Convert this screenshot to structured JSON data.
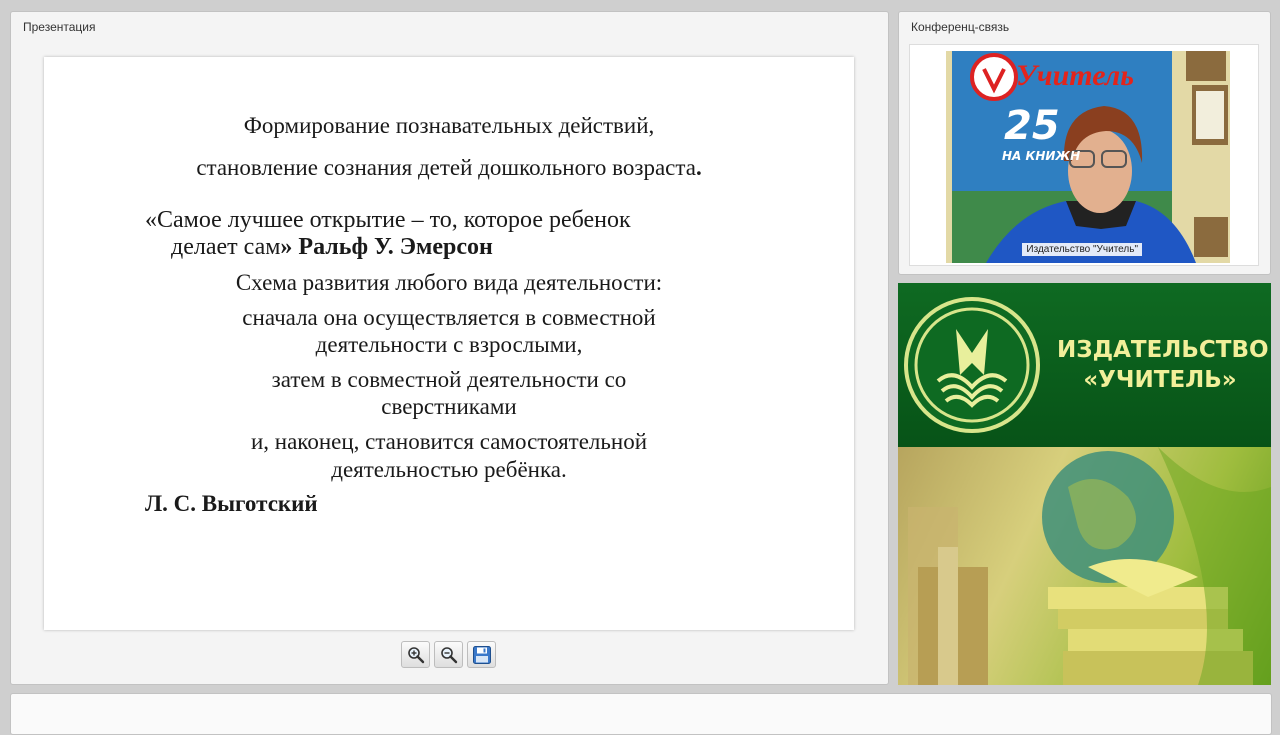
{
  "presentation": {
    "title": "Презентация",
    "slide": {
      "line1": "Формирование познавательных действий,",
      "line2": "становление сознания детей дошкольного возраста",
      "line2_end": ".",
      "quote_line1": "«Самое лучшее открытие – то, которое ребенок",
      "quote_line2_a": "делает сам",
      "quote_line2_b": "» Ральф У. Эмерсон",
      "scheme_title": "Схема развития любого вида деятельности:",
      "step1_a": "сначала она осуществляется в совместной",
      "step1_b": "деятельности с взрослыми,",
      "step2_a": "затем в совместной деятельности со",
      "step2_b": "сверстниками",
      "step3_a": "и, наконец, становится самостоятельной",
      "step3_b": "деятельностью ребёнка.",
      "author": "Л. С. Выготский"
    },
    "toolbar": {
      "zoom_in_icon": "zoom-in-icon",
      "zoom_out_icon": "zoom-out-icon",
      "save_icon": "floppy-disk-icon"
    }
  },
  "conference": {
    "title": "Конференц-связь",
    "video_label": "Издательство \"Учитель\"",
    "poster_text_top": "Учитель",
    "poster_number": "25",
    "poster_text_bottom": "НА КНИЖН"
  },
  "banner": {
    "name_line1": "ИЗДАТЕЛЬСТВО",
    "name_line2": "«УЧИТЕЛЬ»",
    "colors": {
      "green": "#0b5e1c",
      "gold": "#f2ef9a"
    }
  }
}
